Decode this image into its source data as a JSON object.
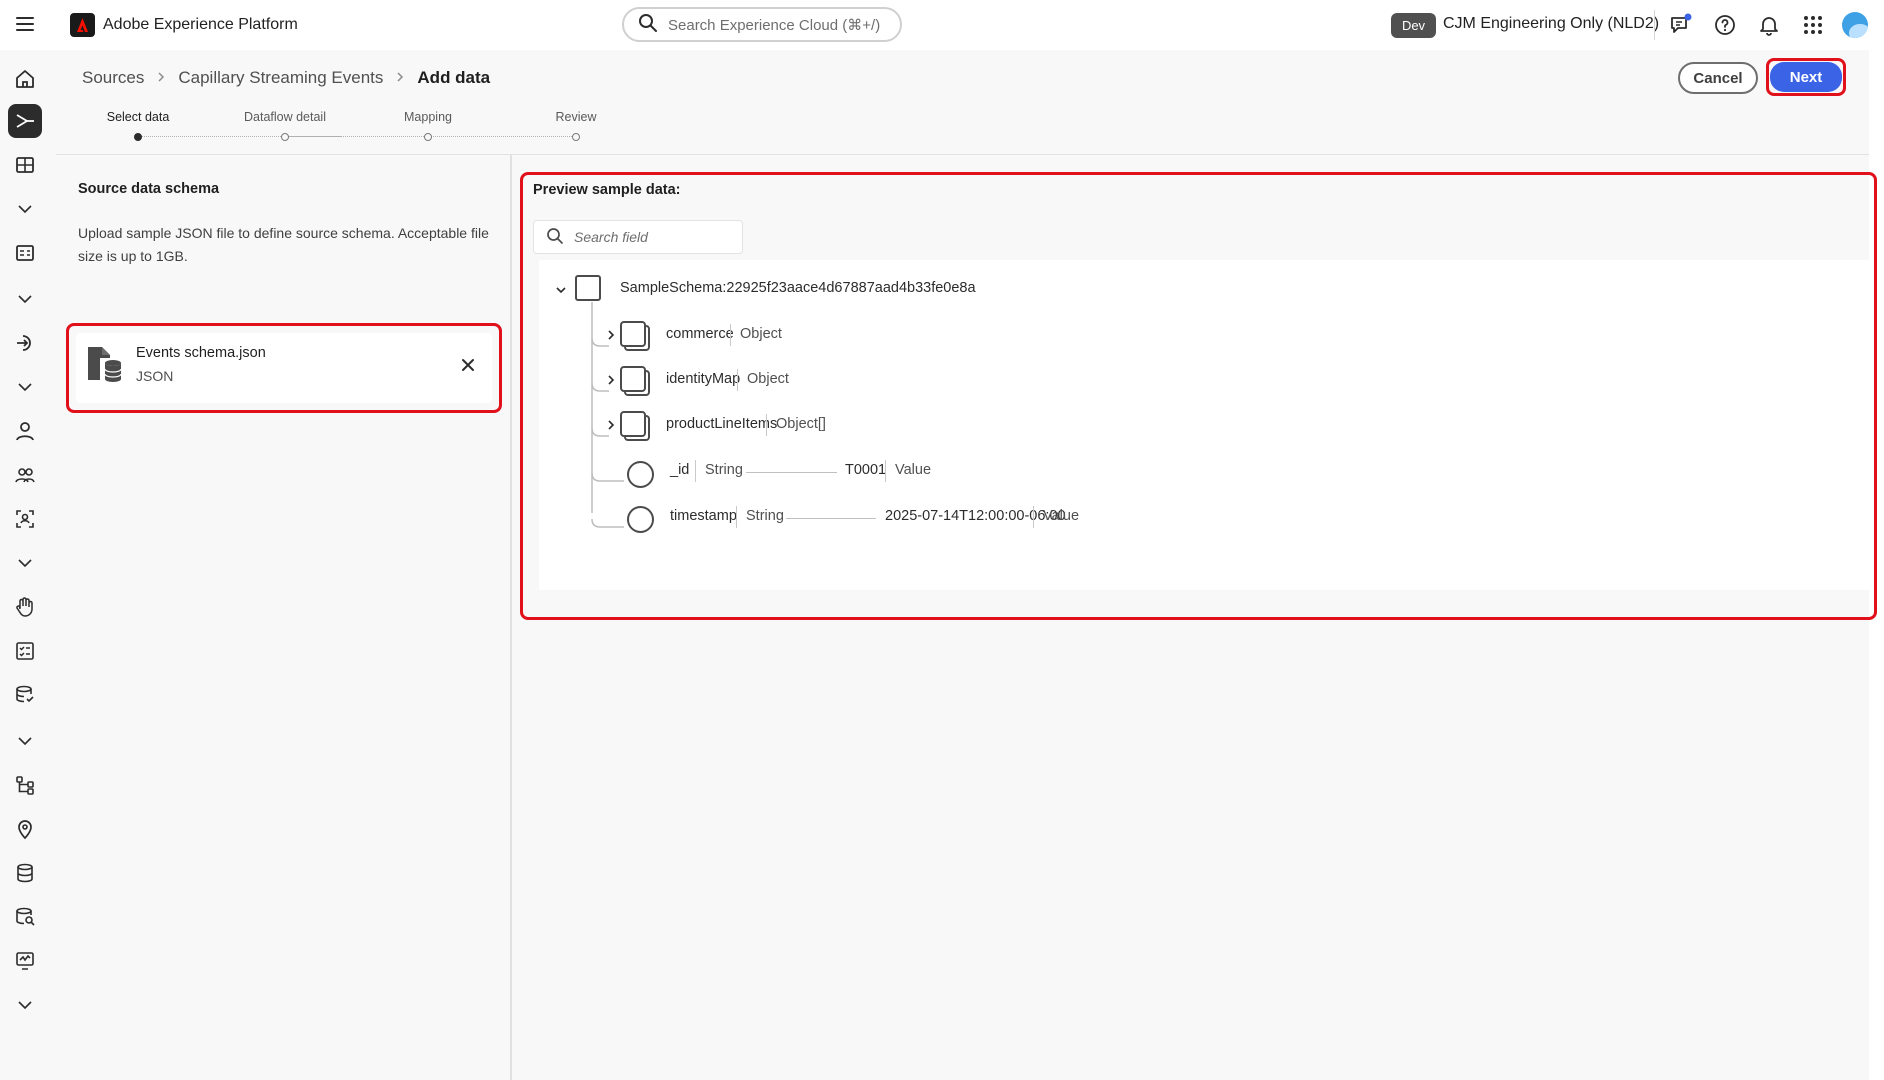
{
  "header": {
    "app_title": "Adobe Experience Platform",
    "search_placeholder": "Search Experience Cloud (⌘+/)",
    "env_badge": "Dev",
    "org_name": "CJM Engineering Only (NLD2)",
    "icons": [
      "menu-icon",
      "adobe-logo",
      "search-icon",
      "feedback-icon",
      "help-icon",
      "notifications-icon",
      "app-switcher-icon",
      "user-avatar"
    ]
  },
  "rail": {
    "items": [
      "home-icon",
      "sources-icon",
      "dashboards-icon",
      "chevron-down-icon",
      "queries-icon",
      "chevron-down-icon",
      "workflows-icon",
      "chevron-down-icon",
      "profile-icon",
      "audiences-icon",
      "identities-icon",
      "chevron-down-icon",
      "consent-icon",
      "journeys-icon",
      "schemas-icon",
      "chevron-down-icon",
      "destinations-icon",
      "location-icon",
      "datasets-icon",
      "data-governance-icon",
      "monitoring-icon",
      "chevron-down-icon"
    ],
    "active": "sources-icon"
  },
  "breadcrumb": {
    "items": [
      "Sources",
      "Capillary Streaming Events"
    ],
    "current": "Add data"
  },
  "actions": {
    "cancel": "Cancel",
    "next": "Next"
  },
  "stepper": {
    "steps": [
      "Select data",
      "Dataflow detail",
      "Mapping",
      "Review"
    ],
    "active_index": 0
  },
  "source_panel": {
    "title": "Source data schema",
    "description": "Upload sample JSON file to define source schema. Acceptable file size is up to 1GB.",
    "file": {
      "name": "Events schema.json",
      "type": "JSON"
    }
  },
  "preview": {
    "title": "Preview sample data:",
    "search_placeholder": "Search field",
    "root": "SampleSchema:22925f23aace4d67887aad4b33fe0e8a",
    "fields": [
      {
        "name": "commerce",
        "type": "Object",
        "kind": "object"
      },
      {
        "name": "identityMap",
        "type": "Object",
        "kind": "object"
      },
      {
        "name": "productLineItems",
        "type": "Object[]",
        "kind": "object"
      },
      {
        "name": "_id",
        "type": "String",
        "kind": "leaf",
        "value": "T0001",
        "value_label": "Value"
      },
      {
        "name": "timestamp",
        "type": "String",
        "kind": "leaf",
        "value": "2025-07-14T12:00:00-06:00",
        "value_label": "Value"
      }
    ]
  }
}
